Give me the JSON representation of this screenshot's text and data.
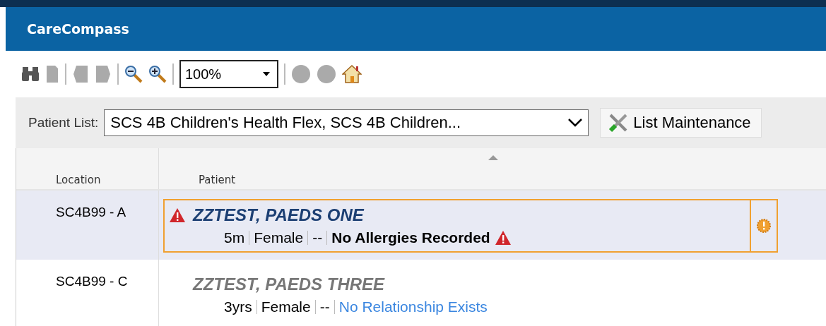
{
  "window": {
    "title": "CareCompass"
  },
  "toolbar": {
    "zoom": "100%"
  },
  "patient_list": {
    "label": "Patient List:",
    "value": "SCS 4B Children's Health Flex, SCS 4B Children...",
    "button": "List Maintenance"
  },
  "table": {
    "columns": [
      "Location",
      "Patient"
    ],
    "rows": [
      {
        "location": "SC4B99 - A",
        "name": "ZZTEST, PAEDS ONE",
        "alert": true,
        "selected": true,
        "age": "5m",
        "sex": "Female",
        "dashes": "--",
        "note": {
          "kind": "allergy",
          "text": "No Allergies Recorded"
        }
      },
      {
        "location": "SC4B99 - C",
        "name": "ZZTEST, PAEDS THREE",
        "alert": false,
        "selected": false,
        "age": "3yrs",
        "sex": "Female",
        "dashes": "--",
        "note": {
          "kind": "relationship",
          "text": "No Relationship Exists"
        }
      }
    ]
  }
}
